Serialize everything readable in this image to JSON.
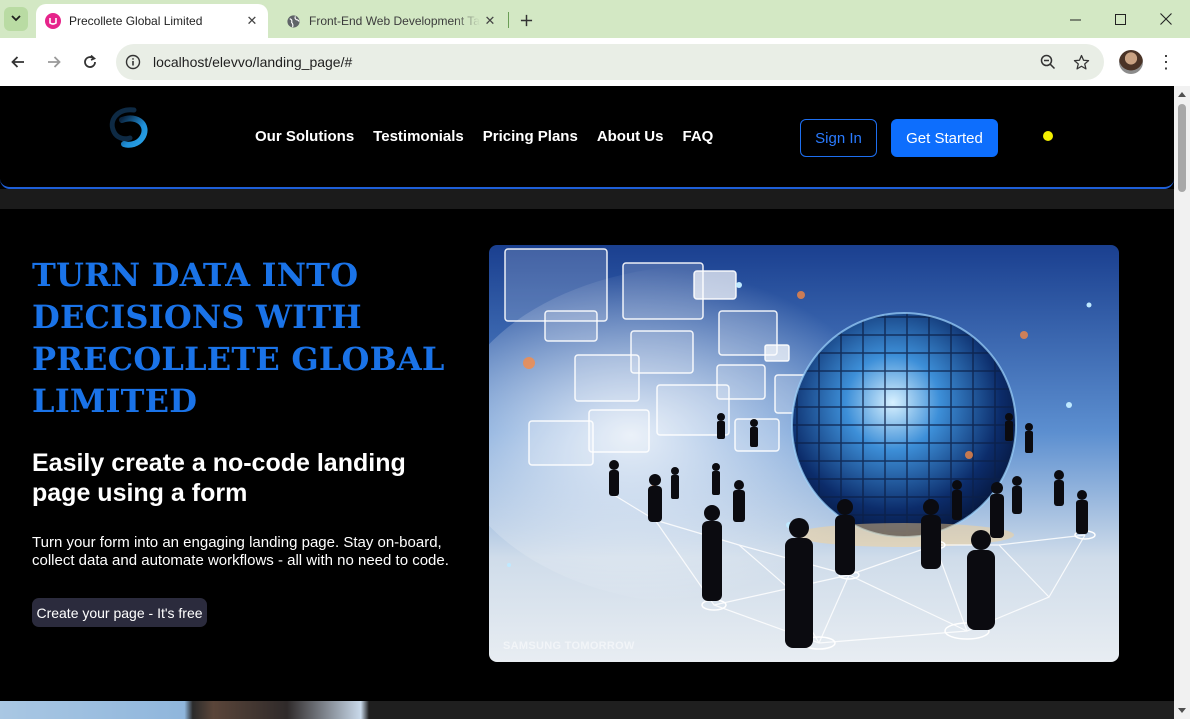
{
  "browser": {
    "tabs": [
      {
        "title": "Precollete Global Limited",
        "active": true
      },
      {
        "title": "Front-End Web Development Ta",
        "active": false
      }
    ],
    "url": "localhost/elevvo/landing_page/#"
  },
  "header": {
    "nav": [
      "Our Solutions",
      "Testimonials",
      "Pricing Plans",
      "About Us",
      "FAQ"
    ],
    "sign_in": "Sign In",
    "get_started": "Get Started"
  },
  "hero": {
    "title": "TURN DATA INTO DECISIONS WITH PRECOLLETE GLOBAL LIMITED",
    "subtitle": "Easily create a no-code landing page using a form",
    "description": "Turn your form into an engaging landing page. Stay on-board, collect data and automate workflows - all with no need to code.",
    "cta": "Create your page - It's free",
    "image_watermark": "SAMSUNG TOMORROW"
  },
  "colors": {
    "accent": "#0d6efd",
    "title_blue": "#1a73e8",
    "theme_toggle": "#f3ef00",
    "tabbar": "#d3e8c4"
  },
  "icons": {
    "tab_favicon": "app-logo-icon",
    "tab2_favicon": "globe-icon",
    "site_info": "info-icon",
    "zoom": "zoom-icon",
    "bookmark": "star-icon"
  }
}
